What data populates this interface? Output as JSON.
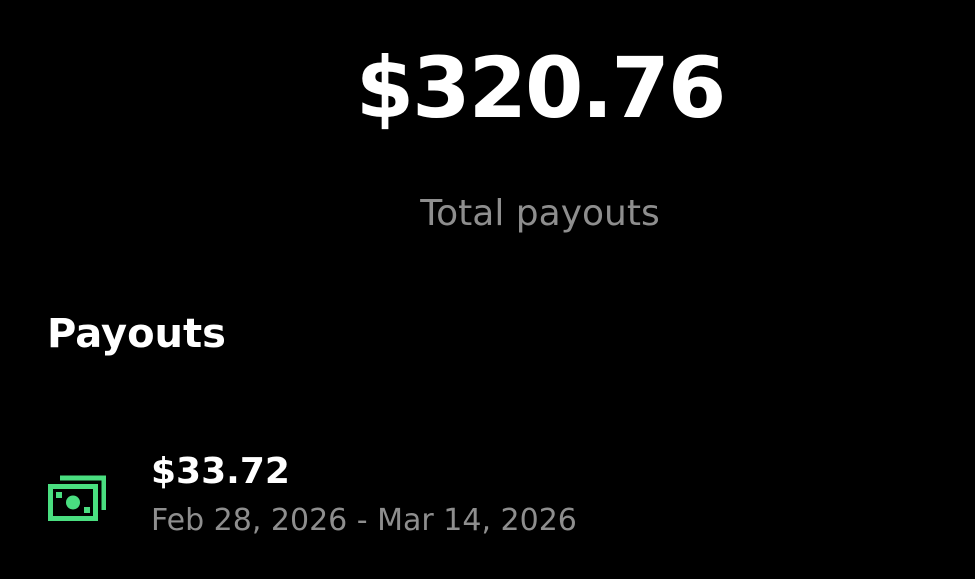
{
  "summary": {
    "total_amount": "$320.76",
    "total_label": "Total payouts"
  },
  "payouts": {
    "title": "Payouts",
    "items": [
      {
        "icon": "money-icon",
        "amount": "$33.72",
        "date_range": "Feb 28, 2026 - Mar 14, 2026"
      }
    ]
  },
  "colors": {
    "background": "#000000",
    "primary_text": "#ffffff",
    "secondary_text": "#8e8e8e",
    "accent_green": "#4ade80"
  }
}
